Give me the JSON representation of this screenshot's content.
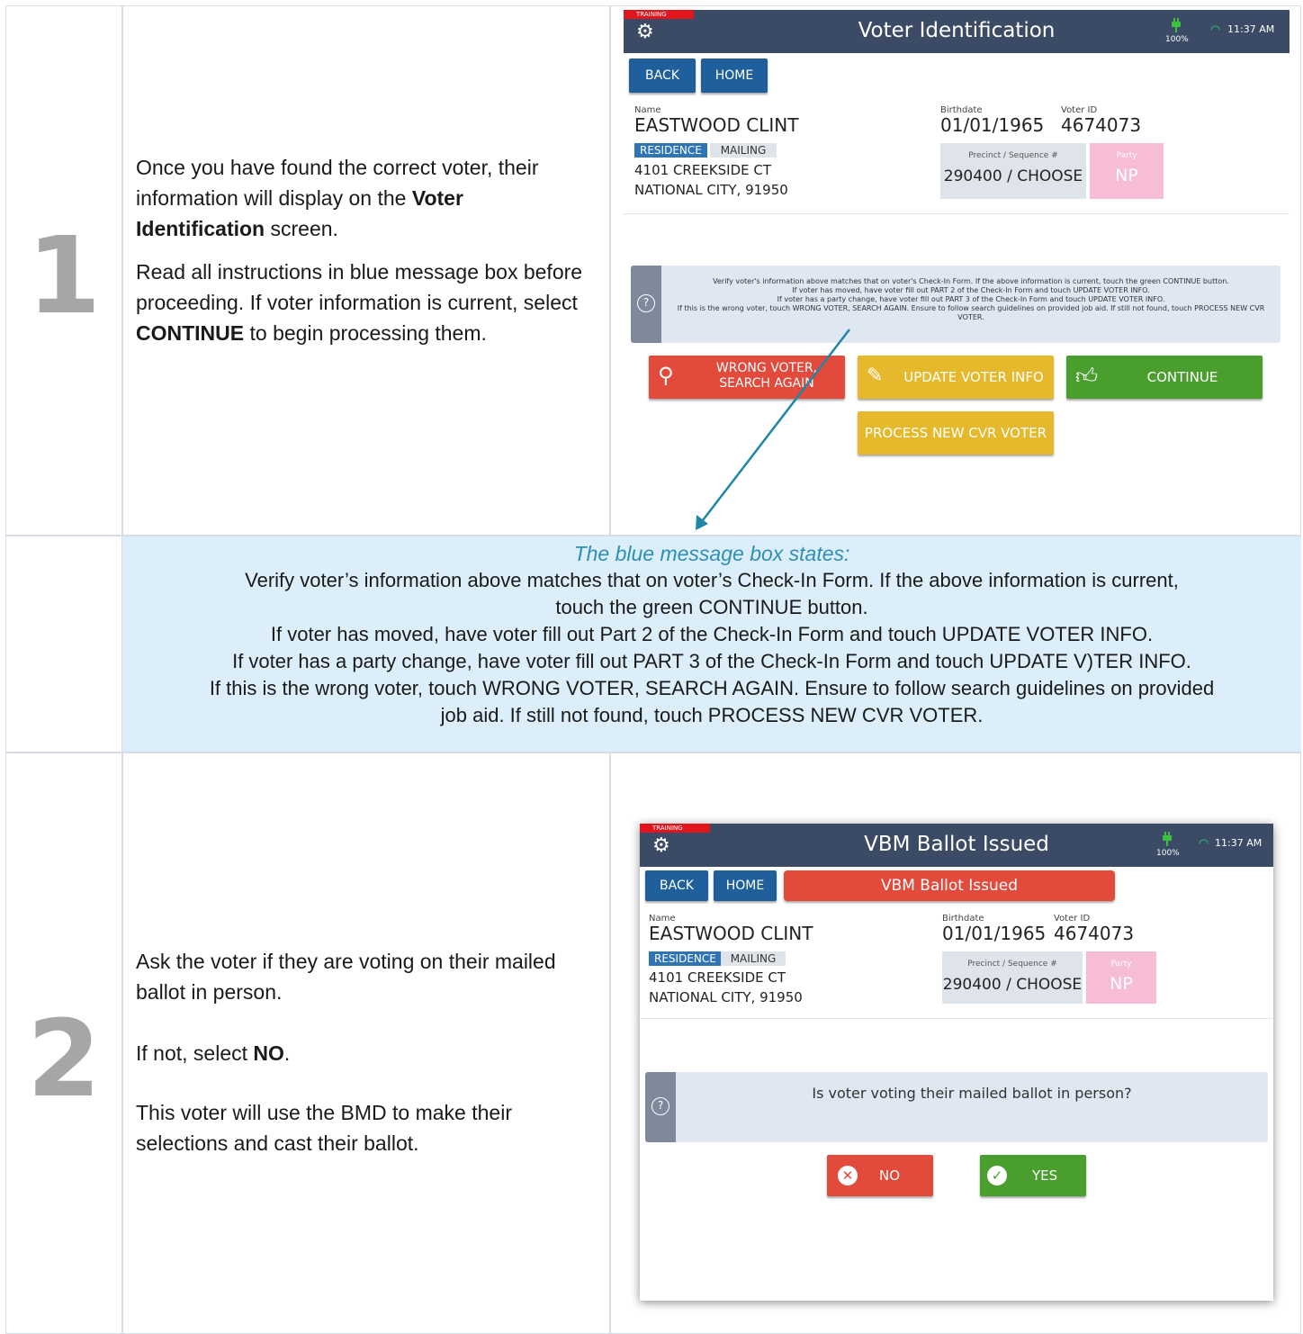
{
  "step1": {
    "number": "1",
    "para1_a": "Once you have found the correct voter, their information will display on the ",
    "para1_b": "Voter Identification",
    "para1_c": " screen.",
    "para2_a": "Read all instructions in blue message box before proceeding. If voter information is current, select ",
    "para2_b": "CONTINUE",
    "para2_c": " to begin processing them.",
    "screen": {
      "training": "TRAINING",
      "title": "Voter Identification",
      "battery": "100%",
      "time": "11:37 AM",
      "back": "BACK",
      "home": "HOME",
      "name_label": "Name",
      "name": "EASTWOOD CLINT",
      "birth_label": "Birthdate",
      "birthdate": "01/01/1965",
      "voterid_label": "Voter ID",
      "voterid": "4674073",
      "tag_res": "RESIDENCE",
      "tag_mail": "MAILING",
      "addr1": "4101 CREEKSIDE  CT",
      "addr2": "NATIONAL CITY, 91950",
      "precinct_label": "Precinct / Sequence #",
      "precinct": "290400 / CHOOSE",
      "party_label": "Party",
      "party": "NP",
      "msg_l1": "Verify voter's information above matches that on voter's Check-In Form. If the above information is current, touch the green CONTINUE button.",
      "msg_l2": "If voter has moved, have voter fill out PART 2 of the Check-In Form and touch UPDATE VOTER INFO.",
      "msg_l3": "If voter has a party change, have voter fill out PART 3 of the Check-In Form and touch UPDATE VOTER INFO.",
      "msg_l4": "If this is the wrong voter, touch WRONG VOTER, SEARCH AGAIN. Ensure to follow search guidelines on provided job aid. If still not found, touch PROCESS NEW CVR VOTER.",
      "btn_wrong_1": "WRONG VOTER,",
      "btn_wrong_2": "SEARCH AGAIN",
      "btn_update": "UPDATE VOTER INFO",
      "btn_continue": "CONTINUE",
      "btn_process": "PROCESS NEW CVR VOTER"
    }
  },
  "band": {
    "heading": "The blue message box states:",
    "line1": "Verify voter’s information above matches that on voter’s Check-In Form. If the above information is current,",
    "line2": "touch the green CONTINUE button.",
    "line3": "If voter has moved, have voter fill out Part 2 of the Check-In Form and touch UPDATE VOTER INFO.",
    "line4": "If voter has a party change, have voter fill out PART 3 of the Check-In Form and touch UPDATE V)TER INFO.",
    "line5": "If this is the wrong voter, touch WRONG VOTER, SEARCH AGAIN. Ensure to follow search guidelines on provided",
    "line6": "job aid. If still not found, touch PROCESS NEW CVR VOTER."
  },
  "step2": {
    "number": "2",
    "para1": "Ask the voter if they are voting on their mailed ballot in person.",
    "para2_a": "If not, select ",
    "para2_b": "NO",
    "para2_c": ".",
    "para3": "This voter will use the BMD to make their selections and cast their ballot.",
    "screen": {
      "training": "TRAINING",
      "title": "VBM Ballot Issued",
      "battery": "100%",
      "time": "11:37 AM",
      "back": "BACK",
      "home": "HOME",
      "banner": "VBM Ballot Issued",
      "name_label": "Name",
      "name": "EASTWOOD CLINT",
      "birth_label": "Birthdate",
      "birthdate": "01/01/1965",
      "voterid_label": "Voter ID",
      "voterid": "4674073",
      "tag_res": "RESIDENCE",
      "tag_mail": "MAILING",
      "addr1": "4101 CREEKSIDE  CT",
      "addr2": "NATIONAL CITY, 91950",
      "precinct_label": "Precinct / Sequence #",
      "precinct": "290400 / CHOOSE",
      "party_label": "Party",
      "party": "NP",
      "question": "Is voter voting their mailed ballot in person?",
      "btn_no": "NO",
      "btn_yes": "YES"
    }
  },
  "colors": {
    "header_bar": "#3b4b66",
    "button_blue": "#1e5f9c",
    "button_red": "#e24a3b",
    "button_yellow": "#e6b92d",
    "button_green": "#4a9e2e",
    "band_background": "#dbeefa",
    "arrow": "#1f86a8"
  }
}
